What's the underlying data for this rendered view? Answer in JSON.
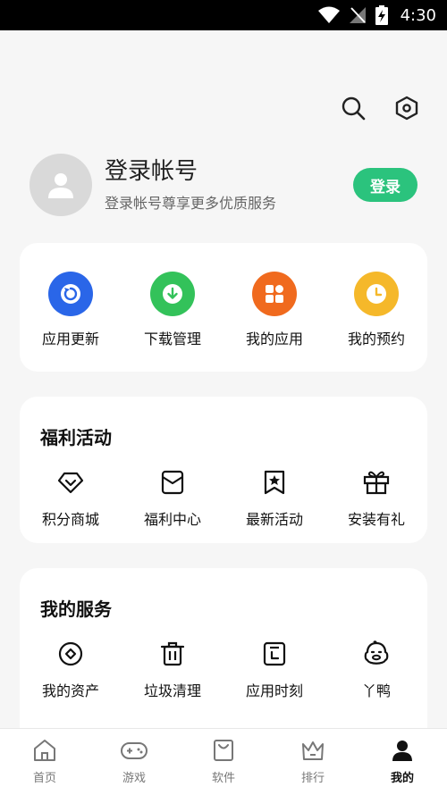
{
  "status_bar": {
    "time": "4:30"
  },
  "profile": {
    "title": "登录帐号",
    "subtitle": "登录帐号尊享更多优质服务",
    "login_label": "登录"
  },
  "quick_actions": [
    {
      "label": "应用更新",
      "icon": "refresh-icon",
      "color": "#2a66e8"
    },
    {
      "label": "下载管理",
      "icon": "download-icon",
      "color": "#33c25a"
    },
    {
      "label": "我的应用",
      "icon": "apps-grid-icon",
      "color": "#f06a1e"
    },
    {
      "label": "我的预约",
      "icon": "clock-icon",
      "color": "#f5b82a"
    }
  ],
  "welfare": {
    "title": "福利活动",
    "items": [
      {
        "label": "积分商城",
        "icon": "diamond-icon"
      },
      {
        "label": "福利中心",
        "icon": "envelope-icon"
      },
      {
        "label": "最新活动",
        "icon": "star-bookmark-icon"
      },
      {
        "label": "安装有礼",
        "icon": "gift-icon"
      }
    ]
  },
  "services": {
    "title": "我的服务",
    "items": [
      {
        "label": "我的资产",
        "icon": "coin-icon"
      },
      {
        "label": "垃圾清理",
        "icon": "trash-icon"
      },
      {
        "label": "应用时刻",
        "icon": "app-time-icon"
      },
      {
        "label": "丫鸭",
        "icon": "duck-icon"
      }
    ]
  },
  "bottom_nav": [
    {
      "label": "首页",
      "icon": "home-icon"
    },
    {
      "label": "游戏",
      "icon": "gamepad-icon"
    },
    {
      "label": "软件",
      "icon": "bag-icon"
    },
    {
      "label": "排行",
      "icon": "crown-icon"
    },
    {
      "label": "我的",
      "icon": "person-icon",
      "active": true
    }
  ]
}
